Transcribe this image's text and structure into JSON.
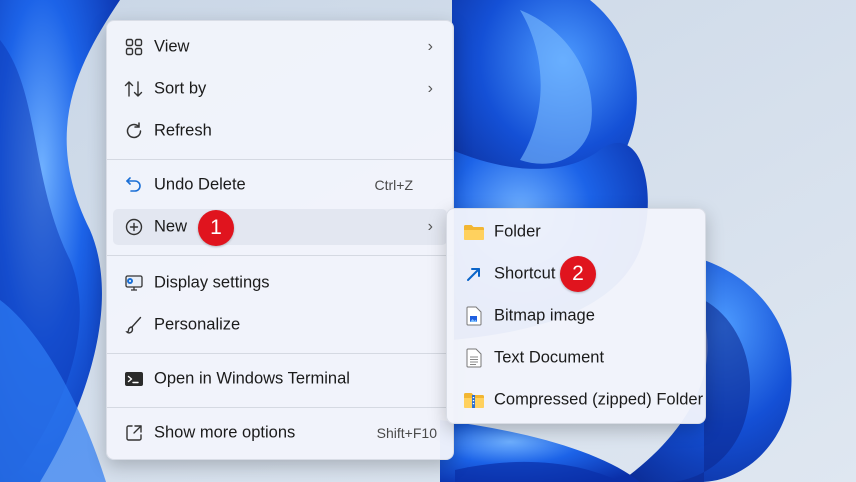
{
  "context_menu": {
    "items": [
      {
        "label": "View",
        "icon": "grid-icon",
        "has_submenu": true
      },
      {
        "label": "Sort by",
        "icon": "sort-icon",
        "has_submenu": true
      },
      {
        "label": "Refresh",
        "icon": "refresh-icon"
      },
      {
        "label": "Undo Delete",
        "icon": "undo-icon",
        "shortcut": "Ctrl+Z"
      },
      {
        "label": "New",
        "icon": "add-circle-icon",
        "has_submenu": true,
        "highlighted": true
      },
      {
        "label": "Display settings",
        "icon": "display-settings-icon"
      },
      {
        "label": "Personalize",
        "icon": "brush-icon"
      },
      {
        "label": "Open in Windows Terminal",
        "icon": "terminal-icon"
      },
      {
        "label": "Show more options",
        "icon": "more-options-icon",
        "shortcut": "Shift+F10"
      }
    ]
  },
  "new_submenu": {
    "items": [
      {
        "label": "Folder",
        "icon": "folder-icon"
      },
      {
        "label": "Shortcut",
        "icon": "shortcut-arrow-icon"
      },
      {
        "label": "Bitmap image",
        "icon": "bitmap-file-icon"
      },
      {
        "label": "Text Document",
        "icon": "text-file-icon"
      },
      {
        "label": "Compressed (zipped) Folder",
        "icon": "zip-folder-icon"
      }
    ]
  },
  "annotations": {
    "step_1": "1",
    "step_2": "2"
  },
  "colors": {
    "badge": "#e0141e",
    "wallpaper_blue": "#1f5fe0",
    "accent_arrow": "#0a64c8"
  }
}
